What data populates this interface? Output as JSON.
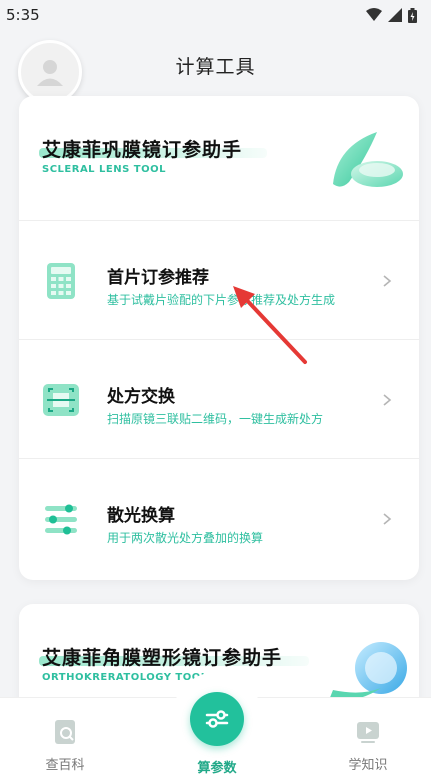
{
  "status_bar": {
    "time": "5:35"
  },
  "header": {
    "title": "计算工具"
  },
  "scleral_card": {
    "title": "艾康菲巩膜镜订参助手",
    "subtitle": "SCLERAL LENS TOOL",
    "items": [
      {
        "title": "首片订参推荐",
        "description": "基于试戴片验配的下片参数推荐及处方生成",
        "icon": "calculator-icon"
      },
      {
        "title": "处方交换",
        "description": "扫描原镜三联贴二维码，一键生成新处方",
        "icon": "qr-scan-icon"
      },
      {
        "title": "散光换算",
        "description": "用于两次散光处方叠加的换算",
        "icon": "sliders-icon"
      }
    ]
  },
  "ortho_card": {
    "title": "艾康菲角膜塑形镜订参助手",
    "subtitle": "ORTHOKRERATOLOGY TOOL"
  },
  "bottom_nav": {
    "left_label": "查百科",
    "center_label": "算参数",
    "right_label": "学知识"
  },
  "colors": {
    "accent": "#22c19c",
    "accent_text": "#2fbfa0",
    "annotation": "#e53935"
  }
}
